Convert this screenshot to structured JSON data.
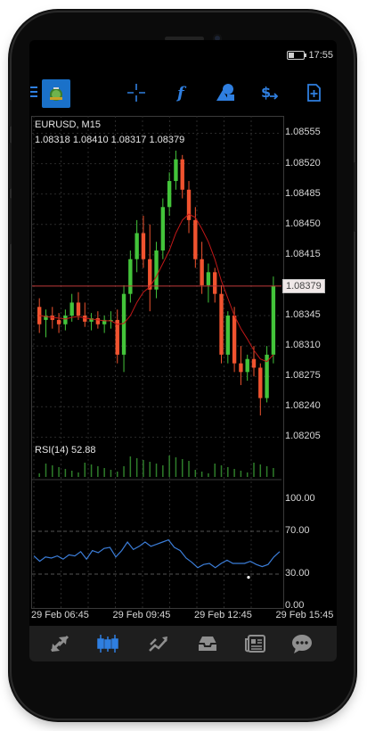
{
  "status": {
    "time": "17:55"
  },
  "toolbar": {
    "items": [
      {
        "name": "crosshair-icon"
      },
      {
        "name": "indicators-icon"
      },
      {
        "name": "objects-icon"
      },
      {
        "name": "symbols-icon"
      },
      {
        "name": "new-order-icon"
      }
    ]
  },
  "chart": {
    "symbol": "EURUSD, M15",
    "ohlc": "1.08318 1.08410 1.08317 1.08379",
    "current_price": "1.08379",
    "price_labels": [
      "1.08555",
      "1.08520",
      "1.08485",
      "1.08450",
      "1.08415",
      "1.08345",
      "1.08310",
      "1.08275",
      "1.08240",
      "1.08205"
    ],
    "rsi_label": "RSI(14) 52.88",
    "rsi_levels": [
      "100.00",
      "70.00",
      "30.00",
      "0.00"
    ],
    "time_labels": [
      "29 Feb 06:45",
      "29 Feb 09:45",
      "29 Feb 12:45",
      "29 Feb 15:45"
    ],
    "colors": {
      "bull": "#43c43a",
      "bear": "#f0532f",
      "ma": "#c01818",
      "rsi": "#3b7dd8",
      "current_line": "#c03a3a"
    }
  },
  "chart_data": {
    "type": "candlestick",
    "series": [
      {
        "name": "EURUSD, M15",
        "ohlc": [
          [
            1.08355,
            1.08365,
            1.08325,
            1.08335
          ],
          [
            1.0834,
            1.08352,
            1.0832,
            1.08345
          ],
          [
            1.08345,
            1.08355,
            1.0833,
            1.0834
          ],
          [
            1.0834,
            1.08348,
            1.08325,
            1.08335
          ],
          [
            1.08335,
            1.08352,
            1.08328,
            1.08345
          ],
          [
            1.08345,
            1.0837,
            1.08338,
            1.0836
          ],
          [
            1.0836,
            1.08372,
            1.0834,
            1.08345
          ],
          [
            1.08345,
            1.0836,
            1.08332,
            1.08338
          ],
          [
            1.08338,
            1.08348,
            1.08328,
            1.08342
          ],
          [
            1.08342,
            1.0835,
            1.0833,
            1.08335
          ],
          [
            1.08335,
            1.08345,
            1.08325,
            1.0834
          ],
          [
            1.0834,
            1.0835,
            1.0833,
            1.0834
          ],
          [
            1.0834,
            1.08352,
            1.0829,
            1.083
          ],
          [
            1.083,
            1.0838,
            1.0828,
            1.0837
          ],
          [
            1.0837,
            1.0842,
            1.0836,
            1.0841
          ],
          [
            1.0841,
            1.08455,
            1.08395,
            1.0844
          ],
          [
            1.0844,
            1.0846,
            1.084,
            1.0841
          ],
          [
            1.0841,
            1.0845,
            1.0835,
            1.08375
          ],
          [
            1.08375,
            1.0843,
            1.08365,
            1.0842
          ],
          [
            1.0842,
            1.0848,
            1.0841,
            1.0847
          ],
          [
            1.0847,
            1.0851,
            1.0846,
            1.085
          ],
          [
            1.085,
            1.08535,
            1.0849,
            1.08525
          ],
          [
            1.08525,
            1.0853,
            1.0848,
            1.0849
          ],
          [
            1.0849,
            1.085,
            1.0844,
            1.08455
          ],
          [
            1.08455,
            1.0847,
            1.084,
            1.0841
          ],
          [
            1.0841,
            1.0843,
            1.0837,
            1.0838
          ],
          [
            1.0838,
            1.08405,
            1.0836,
            1.08395
          ],
          [
            1.08395,
            1.084,
            1.0836,
            1.0837
          ],
          [
            1.0837,
            1.0838,
            1.0829,
            1.083
          ],
          [
            1.083,
            1.0835,
            1.0829,
            1.08345
          ],
          [
            1.08345,
            1.08355,
            1.0828,
            1.0829
          ],
          [
            1.0829,
            1.0831,
            1.08265,
            1.0828
          ],
          [
            1.0828,
            1.083,
            1.0827,
            1.08295
          ],
          [
            1.08295,
            1.0831,
            1.08275,
            1.08285
          ],
          [
            1.08285,
            1.0829,
            1.0823,
            1.0825
          ],
          [
            1.0825,
            1.0831,
            1.08245,
            1.083
          ],
          [
            1.083,
            1.0839,
            1.0829,
            1.08379
          ]
        ]
      }
    ],
    "moving_average": [
      1.08345,
      1.08344,
      1.08343,
      1.08342,
      1.08341,
      1.08343,
      1.08344,
      1.08342,
      1.08341,
      1.0834,
      1.08339,
      1.08339,
      1.08335,
      1.08336,
      1.08345,
      1.0836,
      1.08372,
      1.08378,
      1.0839,
      1.08405,
      1.0842,
      1.0844,
      1.08455,
      1.08462,
      1.08458,
      1.08445,
      1.0843,
      1.0841,
      1.08385,
      1.08365,
      1.08345,
      1.0833,
      1.08318,
      1.08305,
      1.08295,
      1.08292,
      1.083
    ],
    "rsi": [
      47,
      42,
      46,
      45,
      47,
      44,
      48,
      47,
      51,
      44,
      52,
      50,
      54,
      55,
      46,
      52,
      60,
      53,
      56,
      60,
      56,
      58,
      60,
      62,
      55,
      52,
      45,
      41,
      36,
      39,
      40,
      36,
      40,
      43,
      40,
      40,
      40,
      42,
      39,
      37,
      39,
      46,
      51
    ],
    "rsi_levels": [
      70,
      30
    ],
    "y_range": [
      1.0819,
      1.08575
    ],
    "rsi_range": [
      0,
      100
    ]
  },
  "nav": {
    "items": [
      {
        "name": "quotes-icon"
      },
      {
        "name": "chart-tab-icon"
      },
      {
        "name": "trade-icon"
      },
      {
        "name": "history-icon"
      },
      {
        "name": "news-icon"
      },
      {
        "name": "chat-icon"
      }
    ]
  }
}
